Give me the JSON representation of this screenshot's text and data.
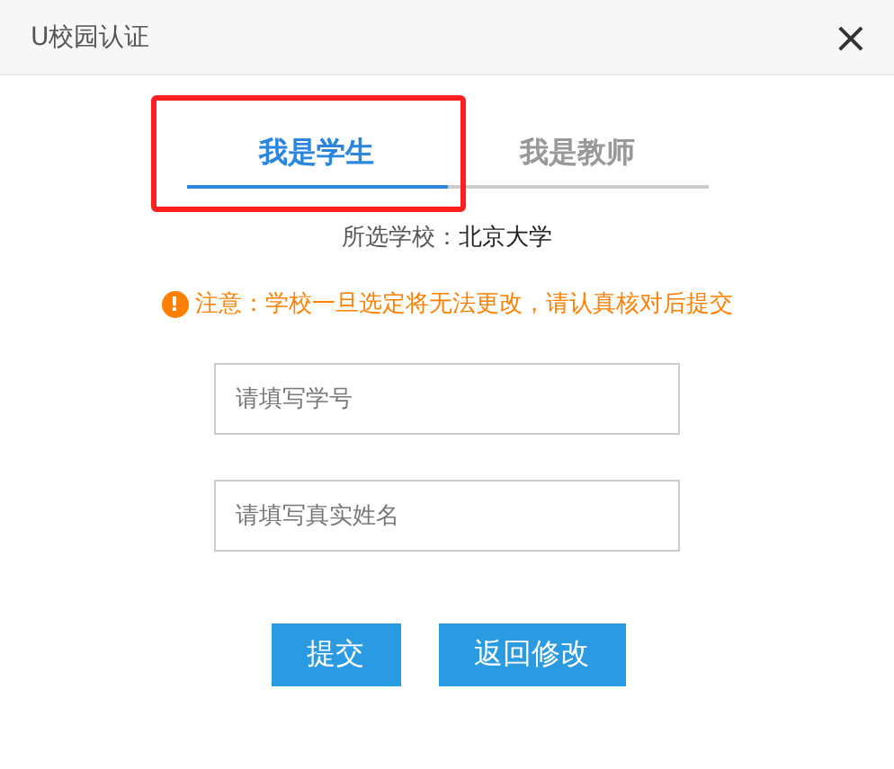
{
  "window": {
    "title": "U校园认证",
    "close": "×"
  },
  "tabs": [
    {
      "label": "我是学生",
      "selected": true
    },
    {
      "label": "我是教师",
      "selected": false
    }
  ],
  "school": {
    "label": "所选学校：",
    "value": "北京大学"
  },
  "notice": {
    "icon": "!",
    "text": "注意：学校一旦选定将无法更改，请认真核对后提交"
  },
  "fields": [
    {
      "placeholder": "请填写学号"
    },
    {
      "placeholder": "请填写真实姓名"
    }
  ],
  "buttons": [
    "提交",
    "返回修改"
  ],
  "highlight": true
}
